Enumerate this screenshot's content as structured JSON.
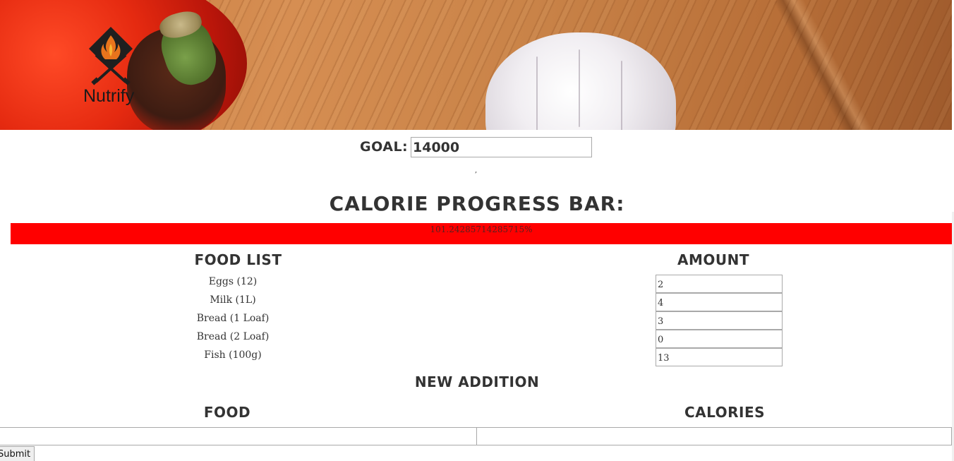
{
  "header": {
    "brand": "Nutrify",
    "logo_icon": "flame-utensils-icon"
  },
  "goal": {
    "label": "GOAL:",
    "value": "14000"
  },
  "separator_mark": ",",
  "progress": {
    "title": "CALORIE PROGRESS BAR:",
    "text": "101.24285714285715%",
    "percent": 101.24285714285715,
    "color": "#ff0000"
  },
  "food_list": {
    "header": "FOOD LIST",
    "items": [
      "Eggs (12)",
      "Milk (1L)",
      "Bread (1 Loaf)",
      "Bread (2 Loaf)",
      "Fish (100g)"
    ]
  },
  "amount": {
    "header": "AMOUNT",
    "values": [
      "2",
      "4",
      "3",
      "0",
      "13"
    ]
  },
  "new_addition": {
    "title": "NEW ADDITION",
    "food_header": "FOOD",
    "calories_header": "CALORIES",
    "food_value": "",
    "calories_value": "",
    "submit_label": "Submit"
  }
}
